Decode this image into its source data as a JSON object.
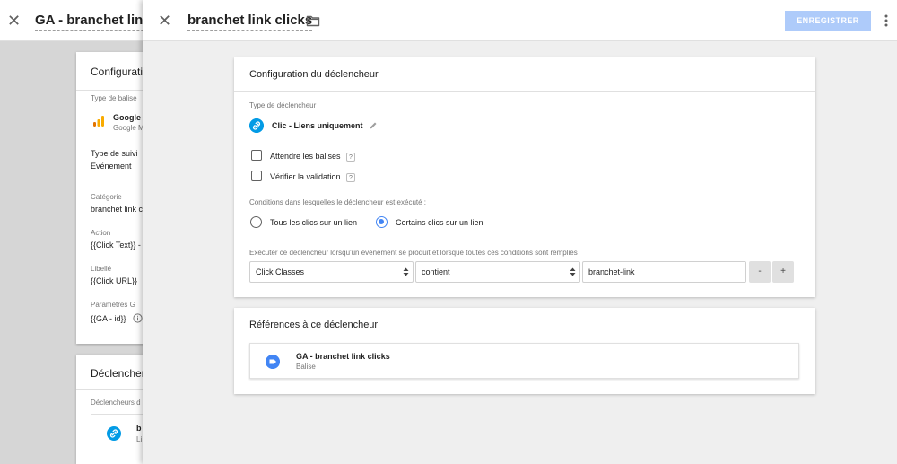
{
  "background": {
    "title": "GA - branchet link c",
    "config_card": {
      "title": "Configuratio",
      "tag_type_label": "Type de balise",
      "tag_name": "Google",
      "tag_sub": "Google M",
      "track_type_label": "Type de suivi",
      "track_type_value": "Événement",
      "category_label": "Catégorie",
      "category_value": "branchet link c",
      "action_label": "Action",
      "action_value": "{{Click Text}} -",
      "label_label": "Libellé",
      "label_value": "{{Click URL}}",
      "params_label": "Paramètres G",
      "params_value": "{{GA - id}}"
    },
    "triggers_card": {
      "title": "Déclenchem",
      "sub_label": "Déclencheurs d",
      "item_name": "b",
      "item_sub": "Li"
    }
  },
  "panel": {
    "title": "branchet link clicks",
    "save_label": "ENREGISTRER",
    "config": {
      "title": "Configuration du déclencheur",
      "trigger_type_label": "Type de déclencheur",
      "trigger_type_name": "Clic - Liens uniquement",
      "wait_tags_label": "Attendre les balises",
      "check_validation_label": "Vérifier la validation",
      "help_glyph": "?",
      "conditions_label": "Conditions dans lesquelles le déclencheur est exécuté :",
      "radio_all": "Tous les clics sur un lien",
      "radio_some": "Certains clics sur un lien",
      "selected_radio": "some",
      "fire_label": "Exécuter ce déclencheur lorsqu'un événement se produit et lorsque toutes ces conditions sont remplies",
      "condition": {
        "variable": "Click Classes",
        "operator": "contient",
        "value": "branchet-link"
      },
      "remove_label": "-",
      "add_label": "+"
    },
    "refs": {
      "title": "Références à ce déclencheur",
      "item_name": "GA - branchet link clicks",
      "item_type": "Balise"
    }
  },
  "colors": {
    "accent": "#4285f4",
    "link_icon": "#039be5",
    "save_disabled": "#aecbfa",
    "ga_orange": "#f9ab00"
  }
}
